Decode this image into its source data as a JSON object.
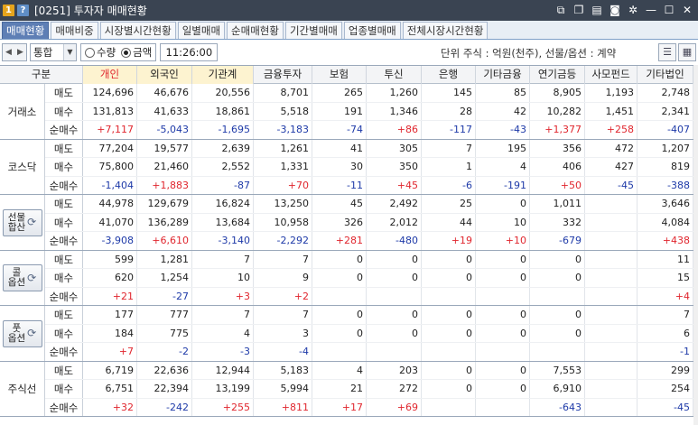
{
  "window": {
    "badge_num": "1",
    "badge_help": "?",
    "title": "[0251] 투자자 매매현황",
    "controls": [
      "link-icon",
      "copy-icon",
      "save-icon",
      "camera-icon",
      "settings-icon",
      "minimize-icon",
      "maximize-icon",
      "close-icon"
    ]
  },
  "tabs": [
    "매매현황",
    "매매비중",
    "시장별시간현황",
    "일별매매",
    "순매매현황",
    "기간별매매",
    "업종별매매",
    "전체시장시간현황"
  ],
  "active_tab": 0,
  "toolbar": {
    "market_select": "통합",
    "radio_qty": "수량",
    "radio_amount": "금액",
    "selected_radio": "amount",
    "time": "11:26:00",
    "unit_text": "단위 주식 : 억원(천주), 선물/옵션 : 계약"
  },
  "columns": [
    "구분",
    "개인",
    "외국인",
    "기관계",
    "금융투자",
    "보험",
    "투신",
    "은행",
    "기타금융",
    "연기금등",
    "사모펀드",
    "기타법인"
  ],
  "row_labels": [
    "매도",
    "매수",
    "순매수"
  ],
  "groups": [
    {
      "name": "거래소",
      "button": false,
      "sell": [
        "124,696",
        "46,676",
        "20,556",
        "8,701",
        "265",
        "1,260",
        "145",
        "85",
        "8,905",
        "1,193",
        "2,748"
      ],
      "buy": [
        "131,813",
        "41,633",
        "18,861",
        "5,518",
        "191",
        "1,346",
        "28",
        "42",
        "10,282",
        "1,451",
        "2,341"
      ],
      "net": [
        "+7,117",
        "-5,043",
        "-1,695",
        "-3,183",
        "-74",
        "+86",
        "-117",
        "-43",
        "+1,377",
        "+258",
        "-407"
      ]
    },
    {
      "name": "코스닥",
      "button": false,
      "sell": [
        "77,204",
        "19,577",
        "2,639",
        "1,261",
        "41",
        "305",
        "7",
        "195",
        "356",
        "472",
        "1,207"
      ],
      "buy": [
        "75,800",
        "21,460",
        "2,552",
        "1,331",
        "30",
        "350",
        "1",
        "4",
        "406",
        "427",
        "819"
      ],
      "net": [
        "-1,404",
        "+1,883",
        "-87",
        "+70",
        "-11",
        "+45",
        "-6",
        "-191",
        "+50",
        "-45",
        "-388"
      ]
    },
    {
      "name": "선물합산",
      "button": true,
      "btn_line1": "선물",
      "btn_line2": "합산",
      "sell": [
        "44,978",
        "129,679",
        "16,824",
        "13,250",
        "45",
        "2,492",
        "25",
        "0",
        "1,011",
        "",
        "3,646"
      ],
      "buy": [
        "41,070",
        "136,289",
        "13,684",
        "10,958",
        "326",
        "2,012",
        "44",
        "10",
        "332",
        "",
        "4,084"
      ],
      "net": [
        "-3,908",
        "+6,610",
        "-3,140",
        "-2,292",
        "+281",
        "-480",
        "+19",
        "+10",
        "-679",
        "",
        "+438"
      ]
    },
    {
      "name": "콜옵션",
      "button": true,
      "btn_line1": "콜",
      "btn_line2": "옵션",
      "sell": [
        "599",
        "1,281",
        "7",
        "7",
        "0",
        "0",
        "0",
        "0",
        "0",
        "",
        "11"
      ],
      "buy": [
        "620",
        "1,254",
        "10",
        "9",
        "0",
        "0",
        "0",
        "0",
        "0",
        "",
        "15"
      ],
      "net": [
        "+21",
        "-27",
        "+3",
        "+2",
        "",
        "",
        "",
        "",
        "",
        "",
        "+4"
      ]
    },
    {
      "name": "풋옵션",
      "button": true,
      "btn_line1": "풋",
      "btn_line2": "옵션",
      "sell": [
        "177",
        "777",
        "7",
        "7",
        "0",
        "0",
        "0",
        "0",
        "0",
        "",
        "7"
      ],
      "buy": [
        "184",
        "775",
        "4",
        "3",
        "0",
        "0",
        "0",
        "0",
        "0",
        "",
        "6"
      ],
      "net": [
        "+7",
        "-2",
        "-3",
        "-4",
        "",
        "",
        "",
        "",
        "",
        "",
        "-1"
      ]
    },
    {
      "name": "주식선",
      "button": false,
      "sell": [
        "6,719",
        "22,636",
        "12,944",
        "5,183",
        "4",
        "203",
        "0",
        "0",
        "7,553",
        "",
        "299"
      ],
      "buy": [
        "6,751",
        "22,394",
        "13,199",
        "5,994",
        "21",
        "272",
        "0",
        "0",
        "6,910",
        "",
        "254"
      ],
      "net": [
        "+32",
        "-242",
        "+255",
        "+811",
        "+17",
        "+69",
        "",
        "",
        "-643",
        "",
        "-45"
      ]
    }
  ],
  "colors": {
    "positive": "#e0262e",
    "negative": "#1e3aa8",
    "header_bg": "#f3f4f6",
    "active_tab": "#5e7fb5",
    "titlebar": "#3a4452"
  }
}
